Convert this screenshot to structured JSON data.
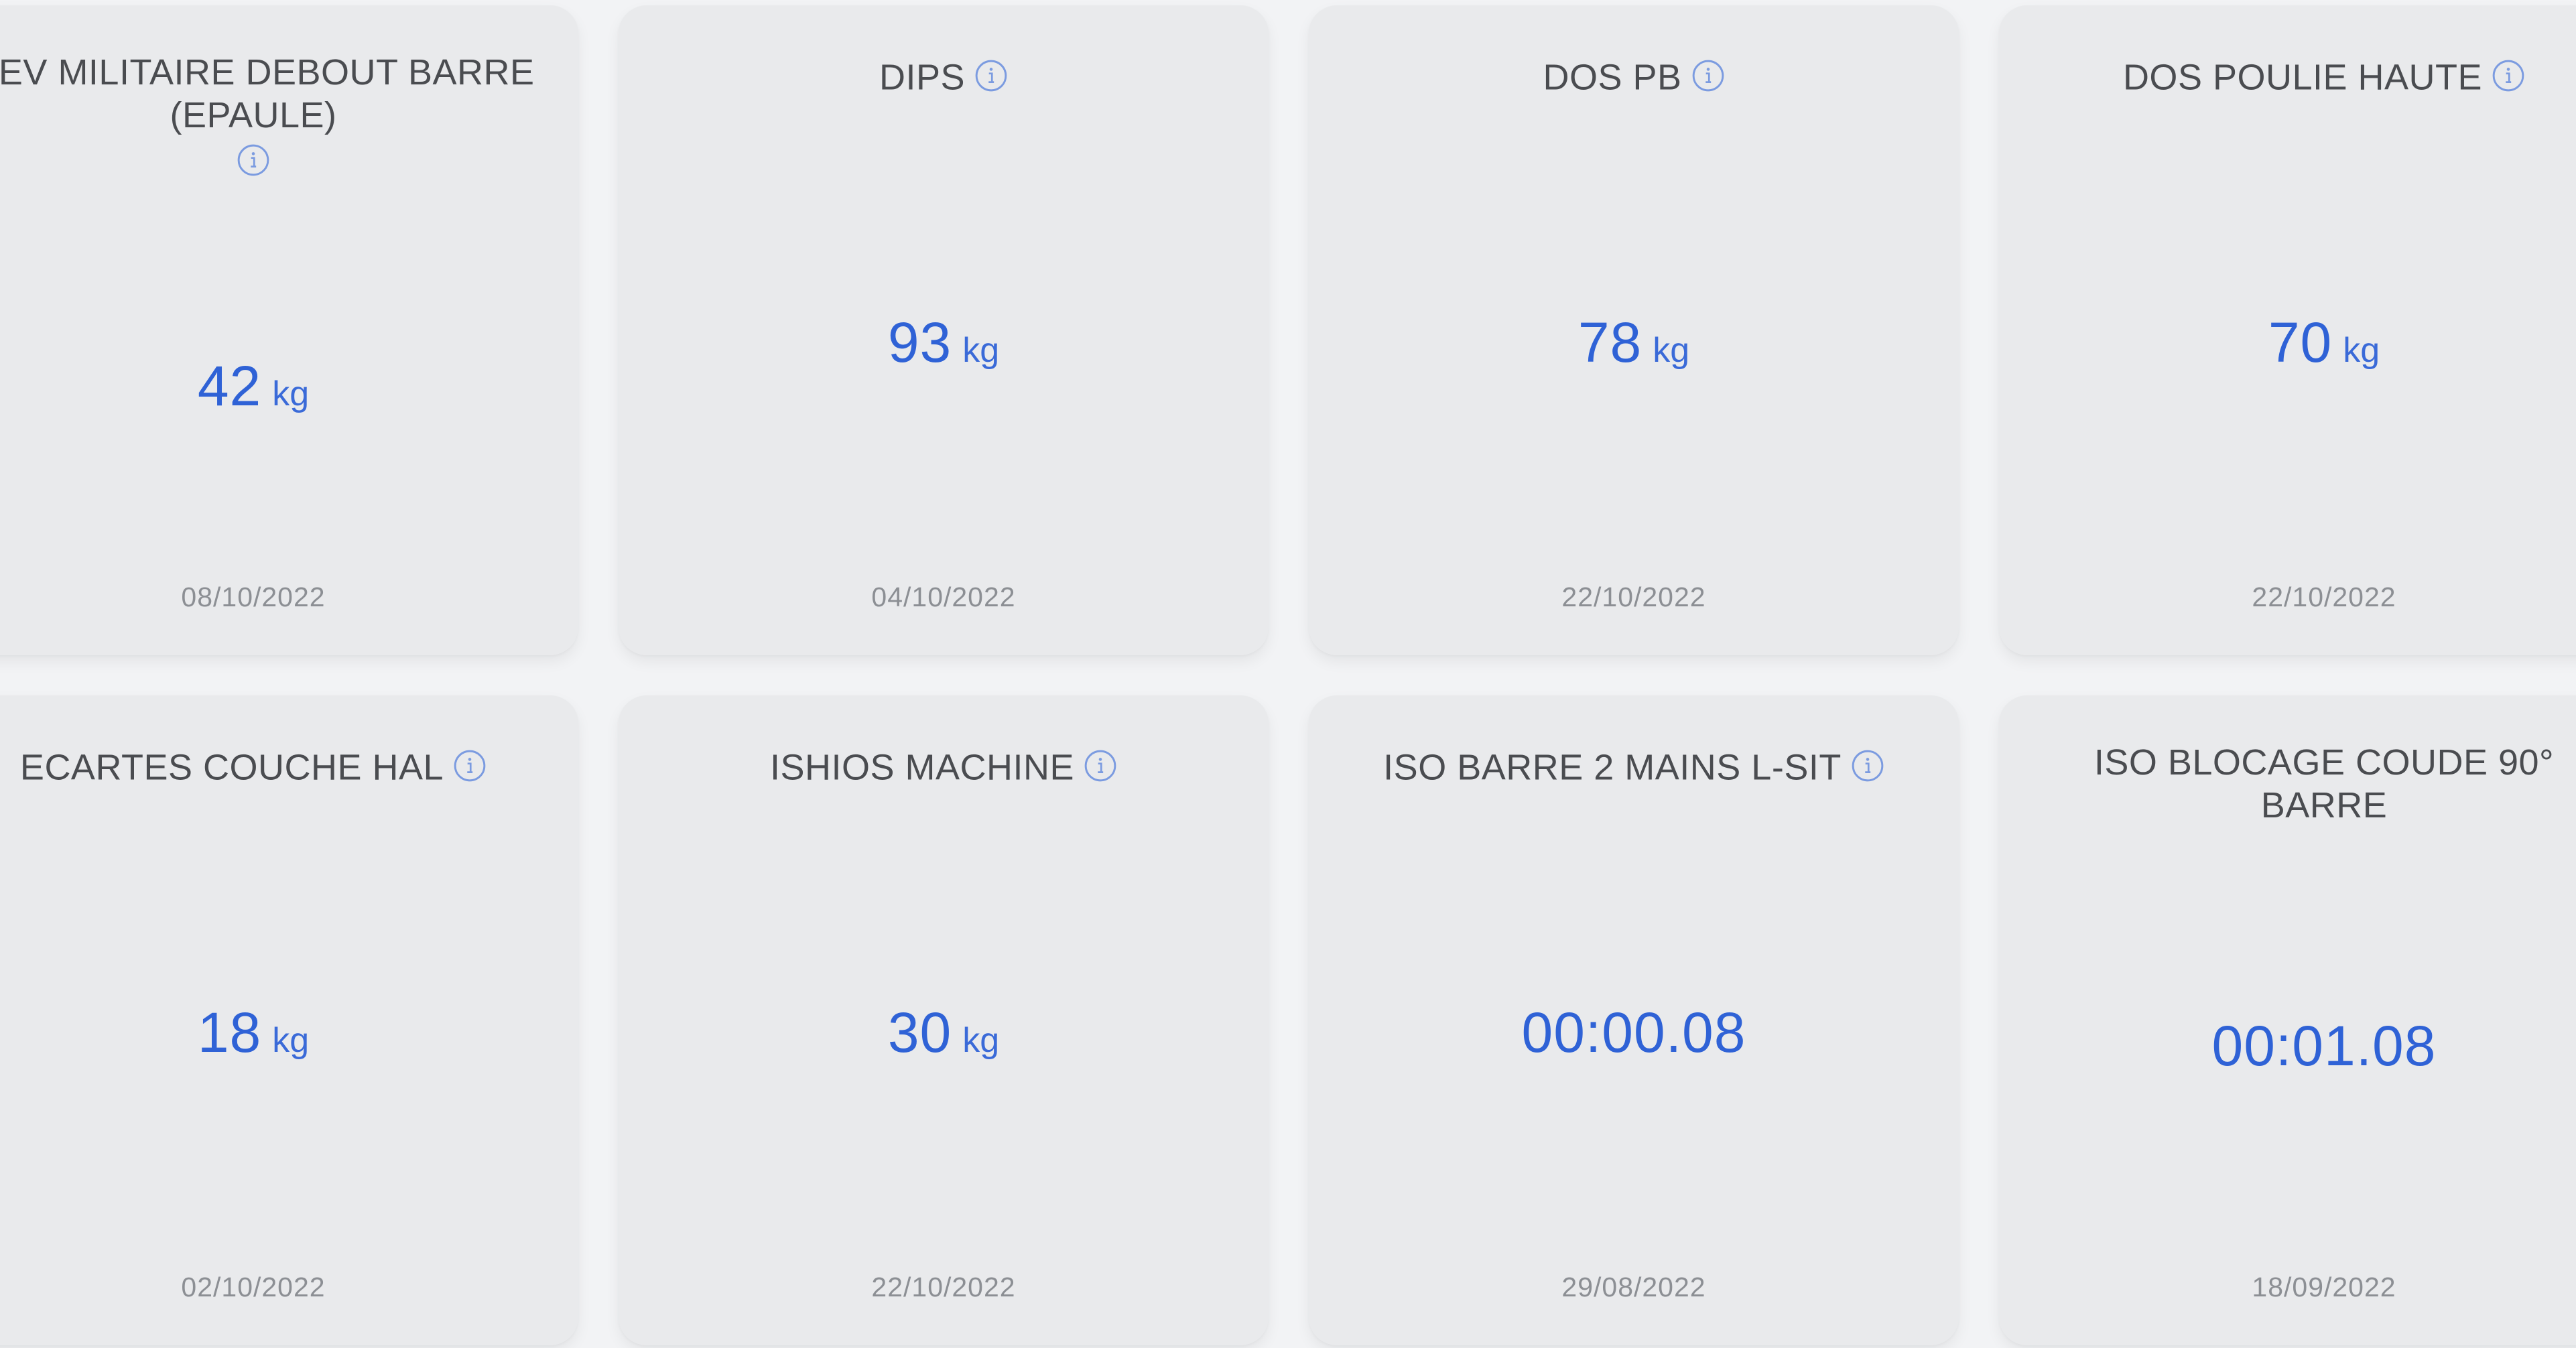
{
  "cards": [
    {
      "title_lines": [
        "DEV MILITAIRE DEBOUT BARRE",
        "(EPAULE)"
      ],
      "value": "42",
      "unit": "kg",
      "date": "08/10/2022",
      "has_info": true
    },
    {
      "title_lines": [
        "DIPS"
      ],
      "value": "93",
      "unit": "kg",
      "date": "04/10/2022",
      "has_info": true
    },
    {
      "title_lines": [
        "DOS PB"
      ],
      "value": "78",
      "unit": "kg",
      "date": "22/10/2022",
      "has_info": true
    },
    {
      "title_lines": [
        "DOS POULIE HAUTE"
      ],
      "value": "70",
      "unit": "kg",
      "date": "22/10/2022",
      "has_info": true
    },
    {
      "title_lines": [
        "ECARTES COUCHE HAL"
      ],
      "value": "18",
      "unit": "kg",
      "date": "02/10/2022",
      "has_info": true
    },
    {
      "title_lines": [
        "ISHIOS MACHINE"
      ],
      "value": "30",
      "unit": "kg",
      "date": "22/10/2022",
      "has_info": true
    },
    {
      "title_lines": [
        "ISO BARRE 2 MAINS L-SIT"
      ],
      "value": "00:00.08",
      "unit": "",
      "date": "29/08/2022",
      "has_info": true
    },
    {
      "title_lines": [
        "ISO BLOCAGE COUDE 90°",
        "BARRE"
      ],
      "value": "00:01.08",
      "unit": "",
      "date": "18/09/2022",
      "has_info": false
    }
  ],
  "icons": {
    "info": "info-circle-icon"
  },
  "colors": {
    "background": "#f2f3f5",
    "card": "#e9eaec",
    "title": "#4a4c50",
    "value": "#2f62d6",
    "date": "#8c8f94",
    "info_icon": "#7b9be0"
  }
}
